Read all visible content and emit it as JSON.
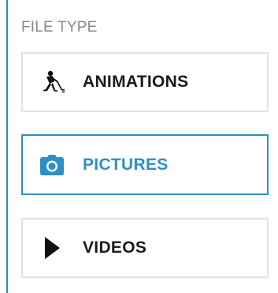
{
  "filter": {
    "title": "FILE TYPE",
    "options": [
      {
        "label": "ANIMATIONS",
        "icon": "hockey-player-icon",
        "selected": false
      },
      {
        "label": "PICTURES",
        "icon": "camera-icon",
        "selected": true
      },
      {
        "label": "VIDEOS",
        "icon": "play-icon",
        "selected": false
      }
    ]
  },
  "colors": {
    "accent": "#2e8fc7",
    "border": "#e3e3e3",
    "title": "#8a8a8a",
    "text": "#1a1a1a"
  }
}
